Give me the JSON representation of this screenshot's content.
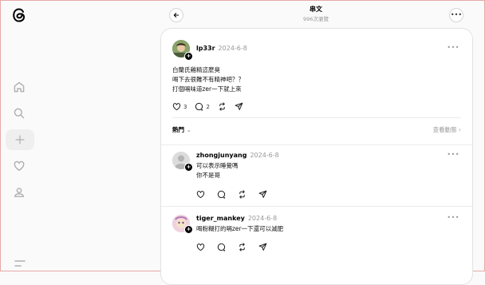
{
  "header": {
    "title": "串文",
    "subtitle": "996次瀏覽"
  },
  "post": {
    "username": "lp33r",
    "time": "2024-6-8",
    "lines": [
      "白蘭氏雞精這麼臭",
      "喝下去很難不有精神吧？？",
      "打個嗝味道zer一下就上來"
    ],
    "likes": "3",
    "comments": "2"
  },
  "sort": {
    "label": "熱門",
    "view_activity": "查看動態"
  },
  "replies": [
    {
      "username": "zhongjunyang",
      "time": "2024-6-8",
      "lines": [
        "可以表示睡覺嗎",
        "你不是哥"
      ]
    },
    {
      "username": "tiger_mankey",
      "time": "2024-6-8",
      "lines": [
        "喝粉糊打的嗝zer一下還可以減肥"
      ]
    }
  ],
  "icons": {
    "logo": "threads-logo-icon",
    "home": "home-icon",
    "search": "search-icon",
    "create": "plus-icon",
    "activity": "heart-icon",
    "profile": "person-icon",
    "menu": "menu-icon"
  },
  "colors": {
    "accent": "#000000",
    "muted": "#999999",
    "nav_icon": "#b0b0b0"
  }
}
